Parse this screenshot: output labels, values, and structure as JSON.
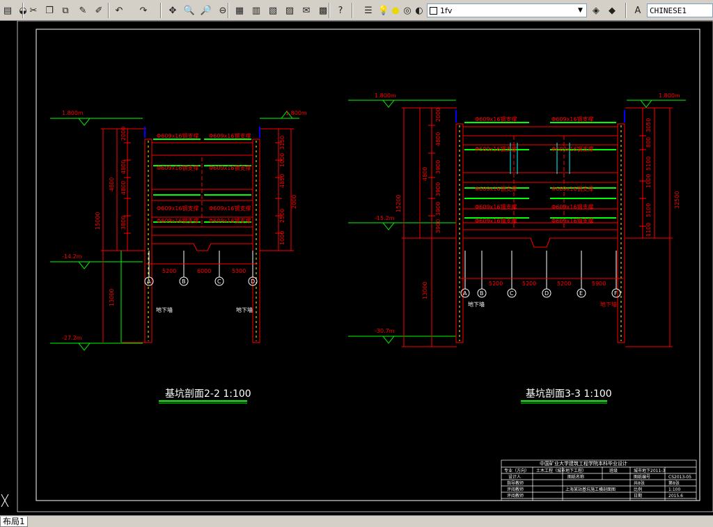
{
  "toolbar": {
    "layer_name": "1fv",
    "text_style": "CHINESE1",
    "icons": [
      "layer-manager-icon",
      "open-icon",
      "cut-icon",
      "copy-icon",
      "paste-icon",
      "brush-icon",
      "match-properties-icon",
      "undo-icon",
      "redo-icon",
      "pan-icon",
      "zoom-realtime-icon",
      "zoom-window-icon",
      "zoom-previous-icon",
      "properties-icon",
      "design-center-icon",
      "tool-palettes-icon",
      "sheet-set-icon",
      "markup-icon",
      "calculator-icon",
      "help-icon",
      "layer-state-icon",
      "bulb-icon",
      "sun-icon",
      "lock-icon",
      "color-swatch-icon",
      "make-current-icon",
      "layer-previous-icon",
      "text-style-icon"
    ]
  },
  "colors": {
    "canvas": "#000000",
    "red": "#ff0000",
    "green": "#00ff00",
    "yellow": "#ffff00",
    "cyan": "#00ffff",
    "white": "#ffffff"
  },
  "drawing": {
    "sec22": {
      "title": "基坑剖面2-2 1:100",
      "elev_top_left": "1.800m",
      "elev_top_right": "1.800m",
      "elev_mid": "-14.2m",
      "elev_bot": "-27.2m",
      "dims_left": [
        "2000",
        "4800",
        "4800",
        "4800",
        "3800",
        "3800",
        "3800",
        "13000"
      ],
      "overall_left": "15000",
      "overall_right": "2000",
      "dims_right": [
        "3150",
        "1000",
        "4850",
        "1000",
        "2200",
        "2500",
        "1000"
      ],
      "strut": "Φ609x16钢支撑",
      "bays": [
        "5200",
        "6000",
        "5300"
      ],
      "axes": [
        "A",
        "B",
        "C",
        "D"
      ],
      "wall_label": "地下墙"
    },
    "sec33": {
      "title": "基坑剖面3-3 1:100",
      "elev_top_left": "1.800m",
      "elev_top_right": "1.800m",
      "elev_mid": "-15.2m",
      "elev_bot": "-30.7m",
      "dims_left": [
        "2000",
        "4800",
        "4800",
        "3900",
        "3900",
        "3900",
        "3900",
        "13000"
      ],
      "overall_left": "15200",
      "overall_right": "32500",
      "dims_right": [
        "3050",
        "800",
        "5100",
        "1000",
        "5100",
        "1100"
      ],
      "strut": "Φ609x16钢支撑",
      "bays": [
        "5200",
        "5200",
        "5200",
        "5900"
      ],
      "axes": [
        "A",
        "B",
        "C",
        "D",
        "E",
        "F"
      ],
      "wall_label": "地下墙"
    },
    "title_block": {
      "header": "中国矿业大学建筑工程学院本科毕业设计",
      "r1": [
        "专业（方向）",
        "土木工程（城市地下工程）",
        "班级",
        "城市地下2011-3"
      ],
      "r2": [
        "设计人",
        "",
        "图纸名称",
        "",
        "图纸编号",
        "CS2013-05"
      ],
      "r3": [
        "指导教师",
        "",
        "",
        "共8张",
        "第8张"
      ],
      "r4": [
        "评阅教师",
        "",
        "上海某站基坑施工横剖面图",
        "比例",
        "1:100"
      ],
      "r5": [
        "评阅教师",
        "",
        "",
        "日期",
        "2015.6"
      ]
    }
  },
  "tabs": {
    "layout1": "布局1"
  }
}
